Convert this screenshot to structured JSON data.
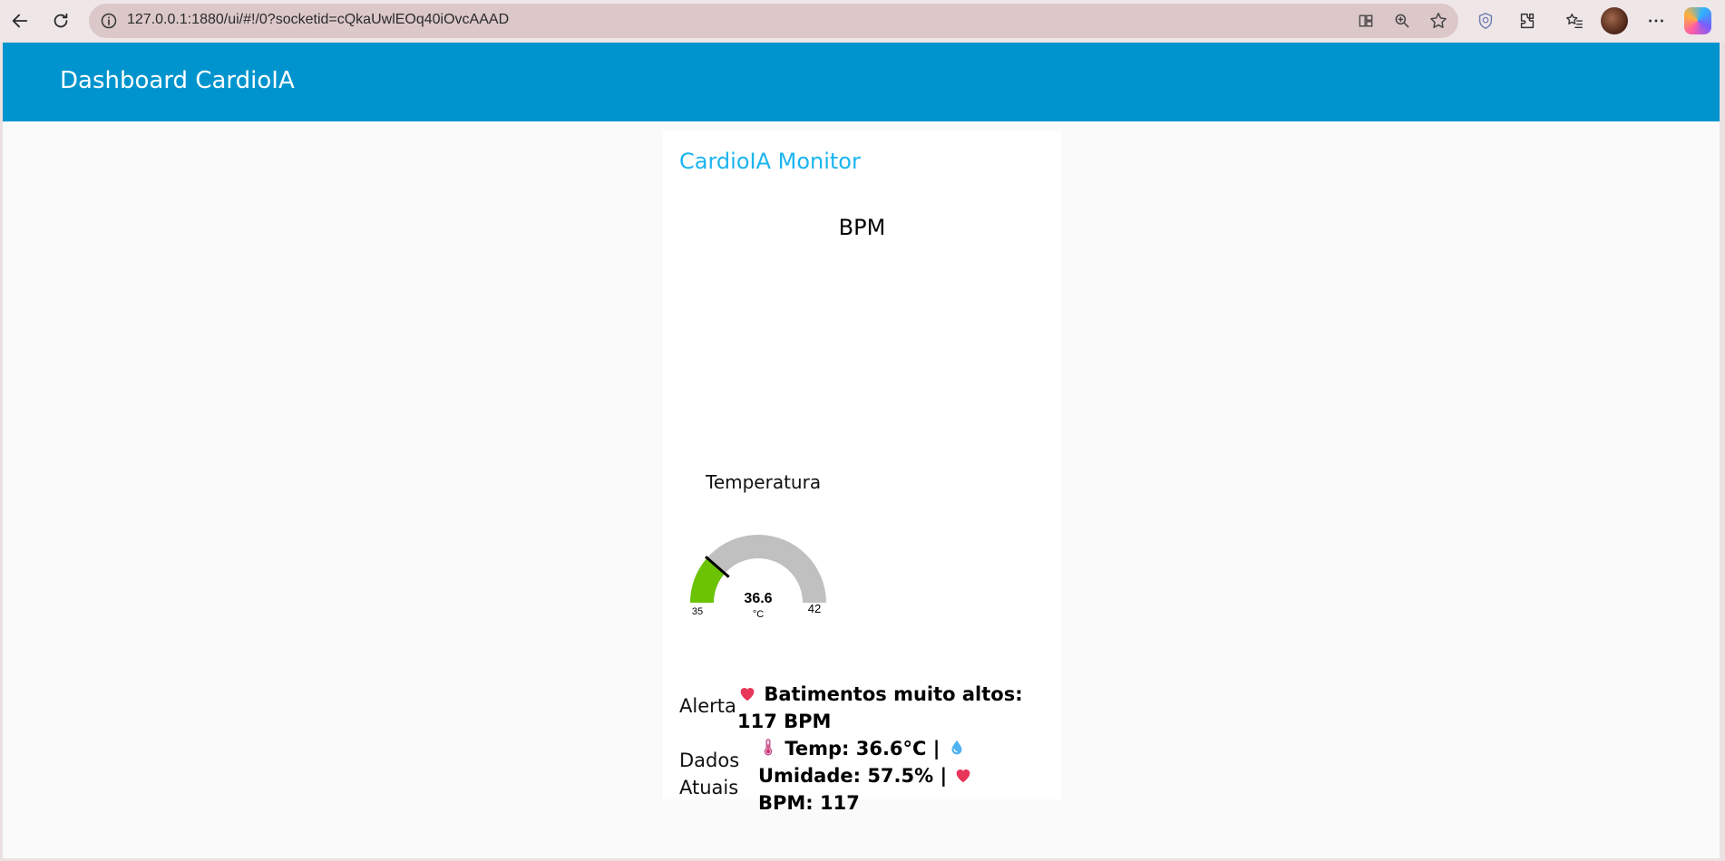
{
  "browser": {
    "url": "127.0.0.1:1880/ui/#!/0?socketid=cQkaUwlEOq40iOvcAAAD"
  },
  "header": {
    "title": "Dashboard CardioIA"
  },
  "card": {
    "title": "CardioIA Monitor",
    "bpm_title": "BPM",
    "temperature": {
      "title": "Temperatura",
      "value": "36.6",
      "units": "°C",
      "min": "35",
      "max": "42",
      "fill_fraction": 0.229,
      "fill_color": "#6bc304",
      "track_color": "#c0c0c0"
    },
    "alert": {
      "label": "Alerta",
      "text": "Batimentos muito altos: 117 BPM",
      "icon": "heart-icon"
    },
    "current": {
      "label_line1": "Dados",
      "label_line2": "Atuais",
      "temp_text": "Temp: 36.6°C |",
      "humidity_text": "Umidade: 57.5% |",
      "bpm_text": "BPM: 117",
      "icons": [
        "thermometer-icon",
        "droplet-icon",
        "heart-icon"
      ]
    }
  },
  "colors": {
    "header": "#0094ce",
    "accent": "#1bb5ef",
    "heart": "#e8355a"
  }
}
